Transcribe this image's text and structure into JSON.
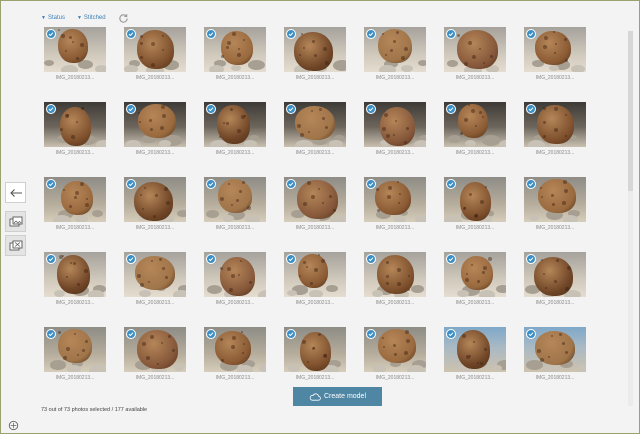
{
  "filters": {
    "status_label": "Status",
    "stitched_label": "Stitched"
  },
  "photo_label": "IMG_20180213...",
  "photo_count": 35,
  "create_button_label": "Create model",
  "selection_status": "73 out of 73 photos selected / 177 available",
  "colors": {
    "accent": "#3b8fc7",
    "button": "#4e86a3",
    "link": "#3d7fb5"
  },
  "icons": {
    "back": "arrow-left-icon",
    "view_selected": "photo-stack-icon",
    "view_unselected": "photo-stack-crossed-icon",
    "refresh": "refresh-icon",
    "create": "cloud-icon",
    "check": "check-icon",
    "corner": "compass-icon"
  }
}
